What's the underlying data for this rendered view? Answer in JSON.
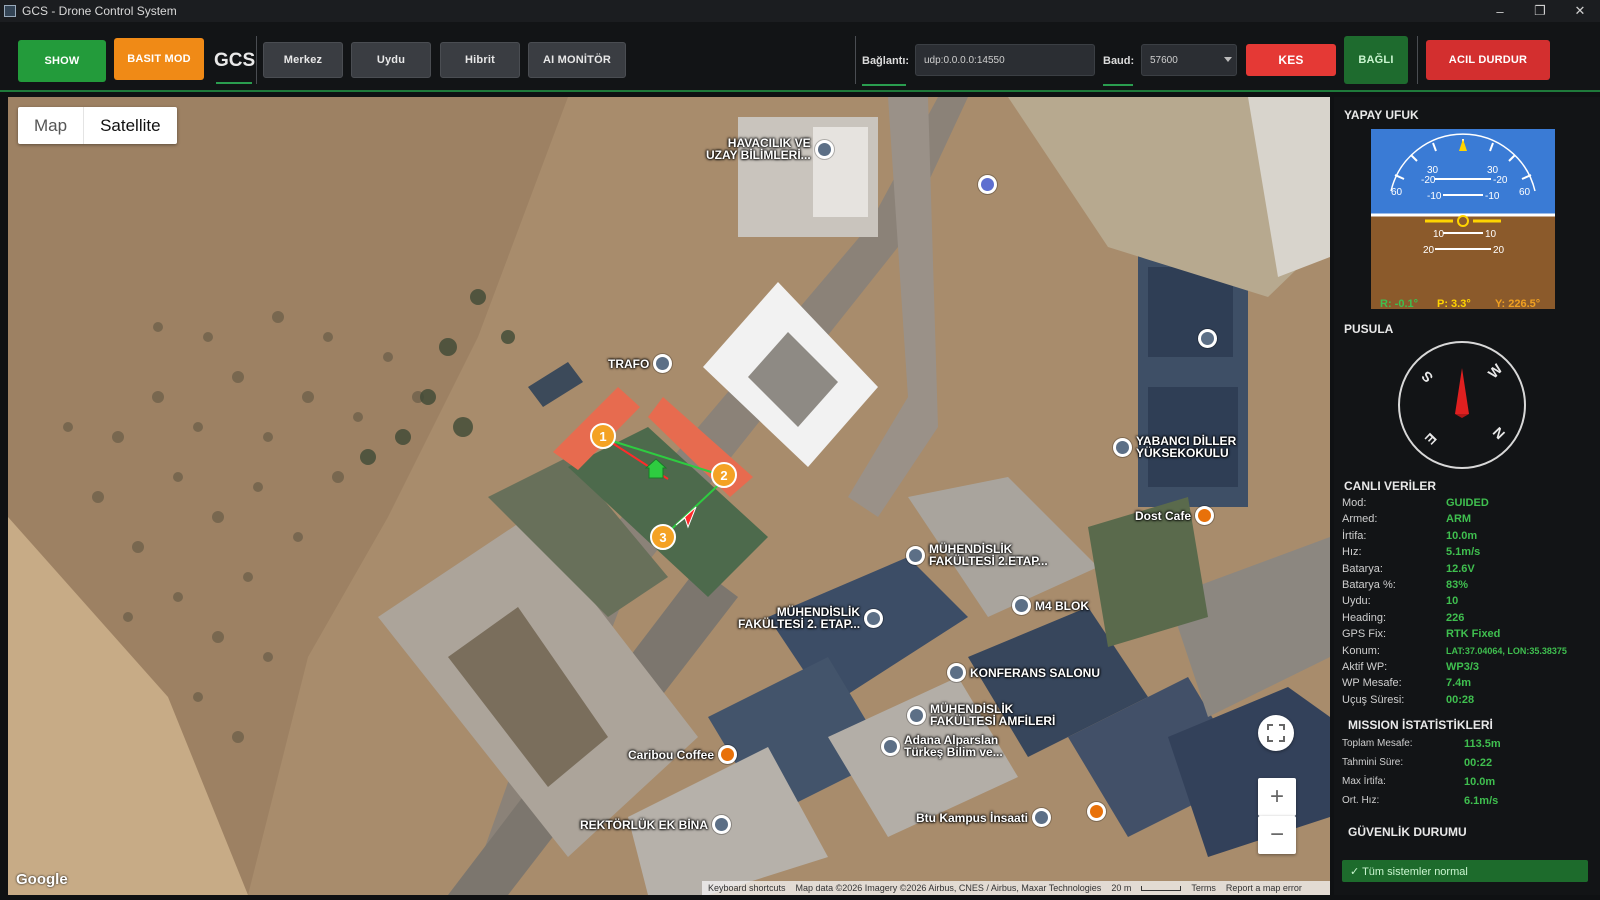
{
  "window": {
    "title": "GCS - Drone Control System",
    "minimize": "–",
    "restore": "❐",
    "close": "✕"
  },
  "toolbar": {
    "show_label": "SHOW",
    "basit_mod_label": "BASIT MOD",
    "gcs_label": "GCS",
    "map_buttons": [
      "Merkez",
      "Uydu",
      "Hibrit",
      "AI MONİTÖR"
    ],
    "connection_label": "Bağlantı:",
    "connection_value": "udp:0.0.0.0:14550",
    "baud_label": "Baud:",
    "baud_value": "57600",
    "disconnect_label": "KES",
    "status_label": "BAĞLI",
    "emergency_label": "ACIL DURDUR",
    "colors": {
      "show": "#239b3b",
      "basit_mod": "#f08a16",
      "disconnect": "#e53935",
      "status": "#1e6b2e",
      "emergency": "#d32f2f"
    }
  },
  "map": {
    "type_map": "Map",
    "type_satellite": "Satellite",
    "selected_type": "Satellite",
    "pois": [
      {
        "label": "HAVACILIK VE\nUZAY BİLİMLERİ...",
        "icon": "school-icon",
        "kind": "blue"
      },
      {
        "label": "",
        "icon": "museum-icon",
        "kind": "blue"
      },
      {
        "label": "TRAFO",
        "icon": "school-icon",
        "kind": "blue"
      },
      {
        "label": "",
        "icon": "school-icon",
        "kind": "blue"
      },
      {
        "label": "YABANCI DİLLER\nYÜKSEKOKULU",
        "icon": "school-icon",
        "kind": "blue"
      },
      {
        "label": "Dost Cafe",
        "icon": "cafe-icon",
        "kind": "orange"
      },
      {
        "label": "MÜHENDİSLİK\nFAKÜLTESİ 2.ETAP...",
        "icon": "school-icon",
        "kind": "blue"
      },
      {
        "label": "MÜHENDİSLİK\nFAKÜLTESİ 2. ETAP...",
        "icon": "school-icon",
        "kind": "blue"
      },
      {
        "label": "M4 BLOK",
        "icon": "school-icon",
        "kind": "blue"
      },
      {
        "label": "KONFERANS SALONU",
        "icon": "school-icon",
        "kind": "blue"
      },
      {
        "label": "MÜHENDİSLİK\nFAKÜLTESİ AMFİLERİ",
        "icon": "school-icon",
        "kind": "blue"
      },
      {
        "label": "Adana Alparslan\nTürkeş Bilim ve...",
        "icon": "school-icon",
        "kind": "blue"
      },
      {
        "label": "Caribou Coffee",
        "icon": "cafe-icon",
        "kind": "orange"
      },
      {
        "label": "REKTÖRLÜK EK BİNA",
        "icon": "school-icon",
        "kind": "blue"
      },
      {
        "label": "Btu Kampus İnsaati",
        "icon": "school-icon",
        "kind": "blue"
      },
      {
        "label": "",
        "icon": "restaurant-icon",
        "kind": "orange"
      }
    ],
    "waypoints": [
      "1",
      "2",
      "3"
    ],
    "home_icon": "home-icon",
    "drone_icon": "drone-arrow-icon",
    "google": "Google",
    "attribution": {
      "shortcuts": "Keyboard shortcuts",
      "data": "Map data ©2026 Imagery ©2026 Airbus, CNES / Airbus, Maxar Technologies",
      "scale": "20 m",
      "terms": "Terms",
      "report": "Report a map error"
    },
    "zoom_in": "+",
    "zoom_out": "−",
    "fullscreen_icon": "fullscreen-icon"
  },
  "horizon": {
    "title": "YAPAY UFUK",
    "roll": "R: -0.1°",
    "pitch": "P: 3.3°",
    "yaw": "Y: 226.5°",
    "roll_value": -0.1,
    "pitch_value": 3.3,
    "yaw_value": 226.5,
    "scale_top": [
      "30",
      "30",
      "-20",
      "-20",
      "60",
      "60",
      "-10",
      "-10"
    ],
    "scale_bottom": [
      "10",
      "10",
      "20",
      "20"
    ],
    "sky_color": "#3a7bd5",
    "ground_color": "#8b5a2b"
  },
  "compass": {
    "title": "PUSULA",
    "heading": 226,
    "letters": [
      "S",
      "W",
      "E",
      "N"
    ]
  },
  "live": {
    "title": "CANLI VERİLER",
    "rows": [
      {
        "label": "Mod:",
        "value": "GUIDED"
      },
      {
        "label": "Armed:",
        "value": "ARM"
      },
      {
        "label": "İrtifa:",
        "value": "10.0m"
      },
      {
        "label": "Hız:",
        "value": "5.1m/s"
      },
      {
        "label": "Batarya:",
        "value": "12.6V"
      },
      {
        "label": "Batarya %:",
        "value": "83%"
      },
      {
        "label": "Uydu:",
        "value": "10"
      },
      {
        "label": "Heading:",
        "value": "226"
      },
      {
        "label": "GPS Fix:",
        "value": "RTK Fixed"
      },
      {
        "label": "Konum:",
        "value": "LAT:37.04064, LON:35.38375"
      },
      {
        "label": "Aktif WP:",
        "value": "WP3/3"
      },
      {
        "label": "WP Mesafe:",
        "value": "7.4m"
      },
      {
        "label": "Uçuş Süresi:",
        "value": "00:28"
      }
    ]
  },
  "mission": {
    "title": "MISSION İSTATİSTİKLERİ",
    "rows": [
      {
        "label": "Toplam Mesafe:",
        "value": "113.5m"
      },
      {
        "label": "Tahmini Süre:",
        "value": "00:22"
      },
      {
        "label": "Max İrtifa:",
        "value": "10.0m"
      },
      {
        "label": "Ort. Hız:",
        "value": "6.1m/s"
      }
    ]
  },
  "safety": {
    "title": "GÜVENLİK DURUMU",
    "status": "✓ Tüm sistemler normal"
  }
}
